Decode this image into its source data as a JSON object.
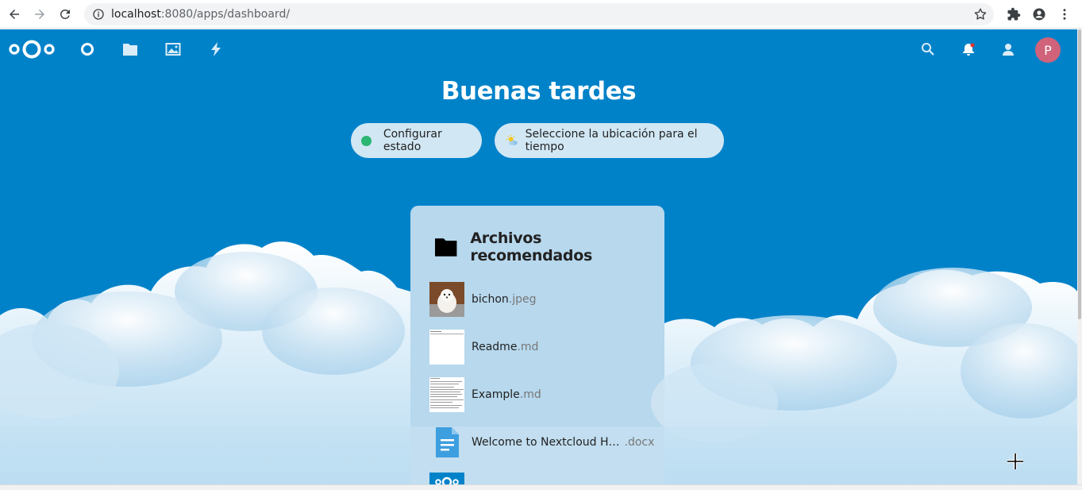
{
  "browser": {
    "url_host": "localhost",
    "url_rest": ":8080/apps/dashboard/",
    "icons": [
      "back-icon",
      "forward-icon",
      "reload-icon",
      "info-icon",
      "star-icon",
      "extensions-icon",
      "profile-icon",
      "menu-icon"
    ]
  },
  "header": {
    "apps": [
      "dashboard-icon",
      "files-icon",
      "photos-icon",
      "activity-icon"
    ],
    "right_icons": [
      "search-icon",
      "notifications-icon",
      "contacts-icon"
    ],
    "avatar_letter": "P",
    "avatar_color": "#d0627a"
  },
  "main": {
    "greeting": "Buenas tardes",
    "status_button": "Configurar estado",
    "weather_button": "Seleccione la ubicación para el tiempo"
  },
  "panel": {
    "title": "Archivos recomendados",
    "files": [
      {
        "name": "bichon",
        "ext": ".jpeg"
      },
      {
        "name": "Readme",
        "ext": ".md"
      },
      {
        "name": "Example",
        "ext": ".md"
      },
      {
        "name": "Welcome to Nextcloud H…",
        "ext": ".docx"
      }
    ]
  },
  "colors": {
    "brand": "#0082c9",
    "status_online": "#2bb673"
  }
}
